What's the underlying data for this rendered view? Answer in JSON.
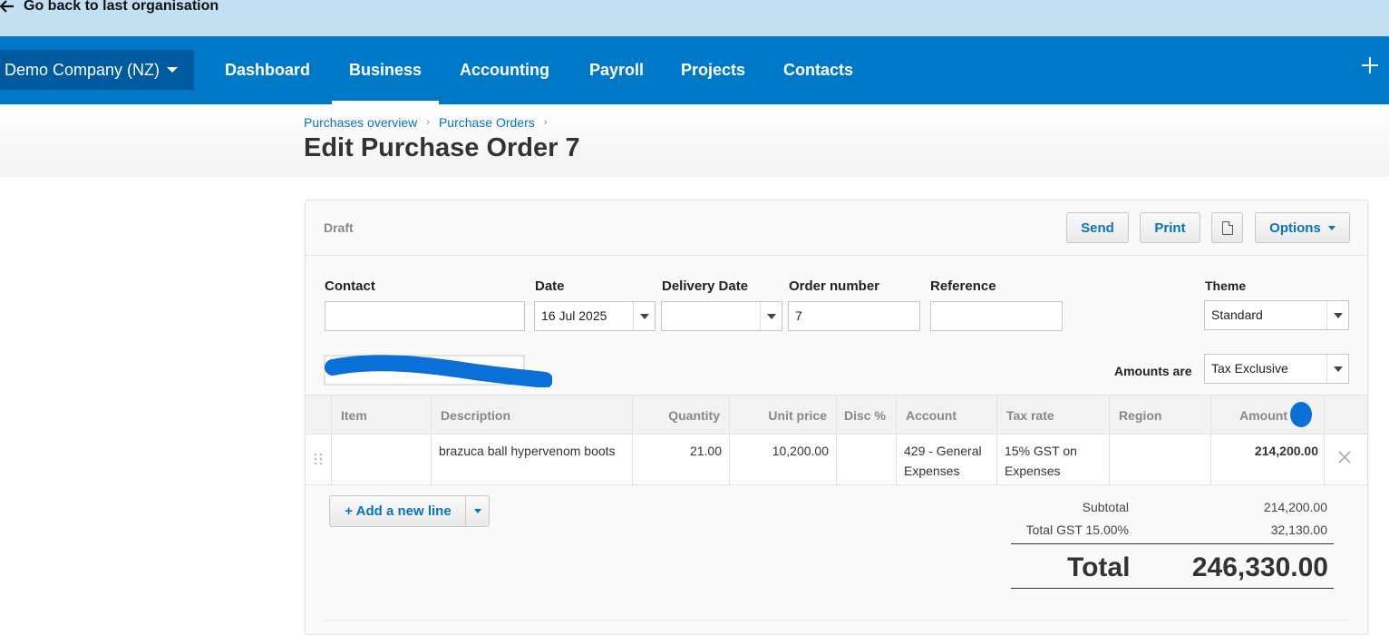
{
  "topbar": {
    "back_label": "Go back to last organisation"
  },
  "nav": {
    "org": "Demo Company (NZ)",
    "items": [
      "Dashboard",
      "Business",
      "Accounting",
      "Payroll",
      "Projects",
      "Contacts"
    ],
    "active": "Business"
  },
  "header": {
    "breadcrumb": [
      "Purchases overview",
      "Purchase Orders"
    ],
    "title": "Edit Purchase Order 7"
  },
  "toolbar": {
    "status": "Draft",
    "send": "Send",
    "print": "Print",
    "options": "Options"
  },
  "form": {
    "contact_label": "Contact",
    "contact_value": "",
    "date_label": "Date",
    "date_value": "16 Jul 2025",
    "delivery_label": "Delivery Date",
    "delivery_value": "",
    "order_label": "Order number",
    "order_value": "7",
    "reference_label": "Reference",
    "reference_value": "",
    "theme_label": "Theme",
    "theme_value": "Standard",
    "amounts_label": "Amounts are",
    "amounts_value": "Tax Exclusive"
  },
  "table": {
    "headers": [
      "Item",
      "Description",
      "Quantity",
      "Unit price",
      "Disc %",
      "Account",
      "Tax rate",
      "Region",
      "Amount N"
    ],
    "rows": [
      {
        "item": "",
        "description": "brazuca ball hypervenom boots",
        "quantity": "21.00",
        "unit_price": "10,200.00",
        "disc": "",
        "account": "429 - General Expenses",
        "tax_rate": "15% GST on Expenses",
        "region": "",
        "amount": "214,200.00"
      }
    ]
  },
  "add_line": "+ Add a new line",
  "totals": {
    "subtotal_label": "Subtotal",
    "subtotal_value": "214,200.00",
    "gst_label": "Total GST 15.00%",
    "gst_value": "32,130.00",
    "total_label": "Total",
    "total_value": "246,330.00"
  },
  "colors": {
    "nav_bg": "#0078c8",
    "org_bg": "#005aa0",
    "topbar_bg": "#c3dff2",
    "link": "#0b73b7",
    "redaction": "#0a6fd6"
  }
}
